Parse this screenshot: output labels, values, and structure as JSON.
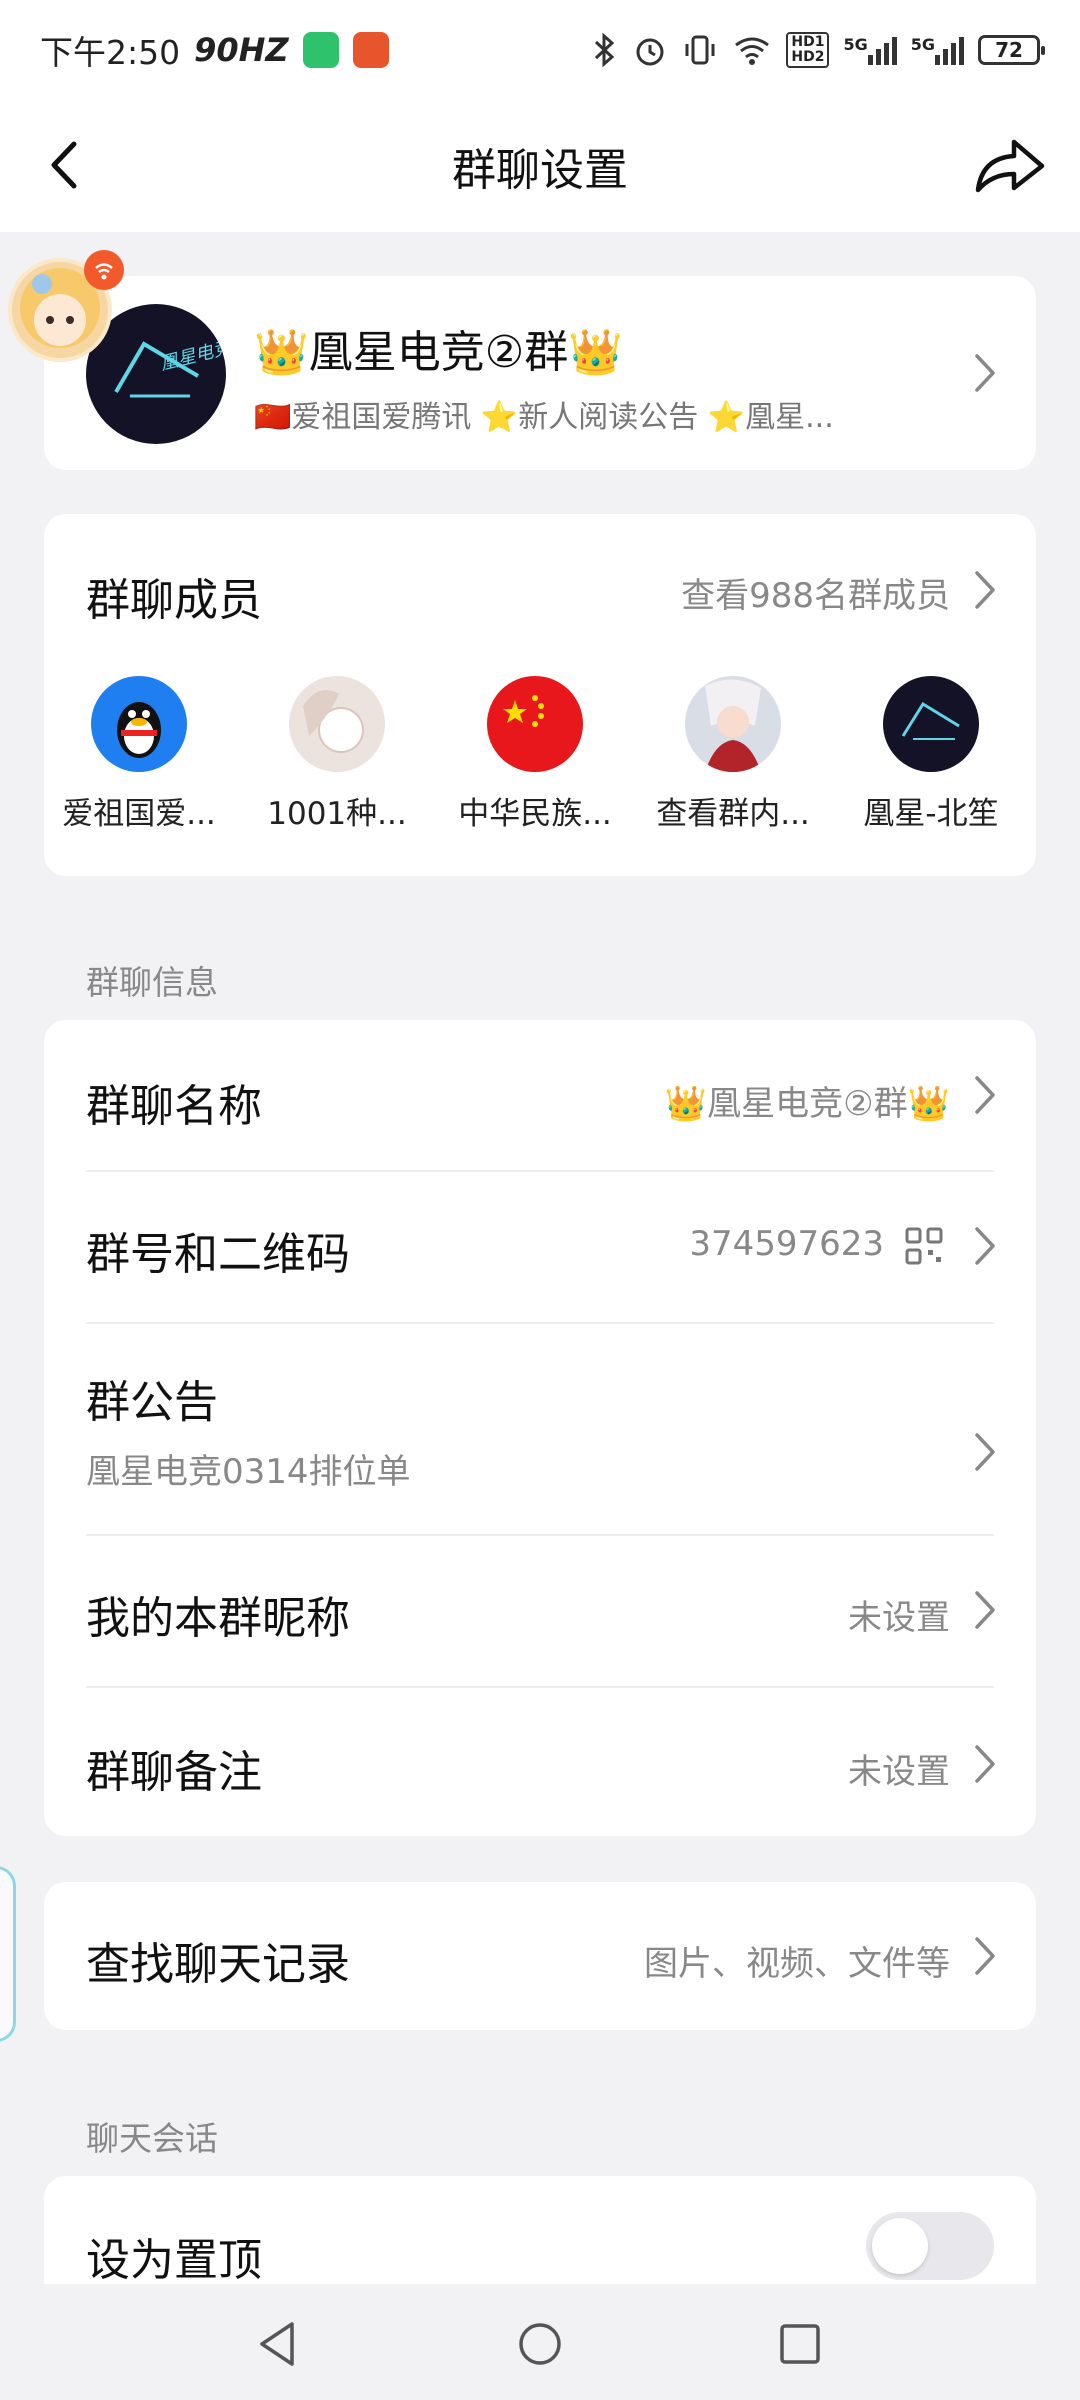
{
  "status": {
    "time": "下午2:50",
    "hz": "90HZ",
    "net_5g_1": "5G",
    "net_5g_2": "5G",
    "hd1": "HD1",
    "hd2": "HD2",
    "battery": "72"
  },
  "nav": {
    "title": "群聊设置"
  },
  "group": {
    "name": "👑凰星电竞②群👑",
    "subtitle": "🇨🇳爱祖国爱腾讯 ⭐新人阅读公告 ⭐凰星..."
  },
  "members": {
    "title": "群聊成员",
    "view_all": "查看988名群成员",
    "list": [
      {
        "name": "爱祖国爱...",
        "avatar": "qq-penguin-icon"
      },
      {
        "name": "1001种...",
        "avatar": "anime-avatar"
      },
      {
        "name": "中华民族...",
        "avatar": "china-flag-icon"
      },
      {
        "name": "查看群内...",
        "avatar": "anime-avatar"
      },
      {
        "name": "凰星-北笙",
        "avatar": "group-logo"
      }
    ]
  },
  "info_section": {
    "label": "群聊信息",
    "group_name_label": "群聊名称",
    "group_name_value": "👑凰星电竞②群👑",
    "group_id_label": "群号和二维码",
    "group_id_value": "374597623",
    "notice_label": "群公告",
    "notice_value": "凰星电竞0314排位单",
    "nickname_label": "我的本群昵称",
    "nickname_value": "未设置",
    "remark_label": "群聊备注",
    "remark_value": "未设置"
  },
  "search": {
    "label": "查找聊天记录",
    "value": "图片、视频、文件等"
  },
  "chat_section": {
    "label": "聊天会话",
    "pin_label": "设为置顶",
    "pin_on": false
  },
  "colors": {
    "background": "#f2f2f5",
    "card": "#ffffff",
    "secondary_text": "#888888"
  }
}
